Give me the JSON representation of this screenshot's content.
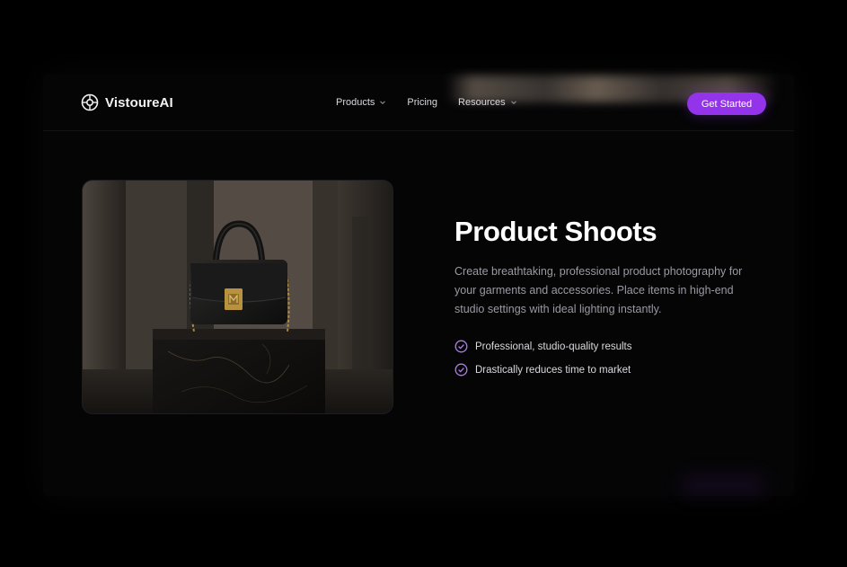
{
  "brand": {
    "name": "VistoureAI",
    "logo_icon": "aperture-icon"
  },
  "nav": {
    "items": [
      {
        "label": "Products",
        "has_dropdown": true
      },
      {
        "label": "Pricing",
        "has_dropdown": false
      },
      {
        "label": "Resources",
        "has_dropdown": true
      }
    ],
    "cta_label": "Get Started"
  },
  "hero": {
    "title": "Product Shoots",
    "description": "Create breathtaking, professional product photography for your garments and accessories. Place items in high-end studio settings with ideal lighting instantly.",
    "features": [
      "Professional, studio-quality results",
      "Drastically reduces time to market"
    ]
  },
  "colors": {
    "accent": "#9333ea",
    "check": "#b07cf0",
    "background": "#000000",
    "text_muted": "#9a9aa3"
  }
}
